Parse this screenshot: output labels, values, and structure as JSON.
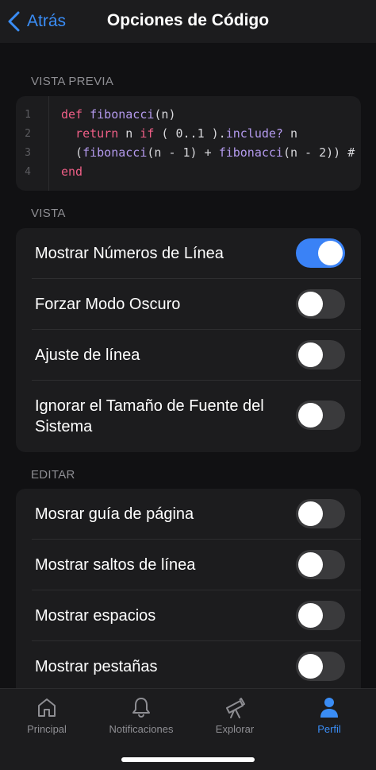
{
  "nav": {
    "back_label": "Atrás",
    "title": "Opciones de Código"
  },
  "preview": {
    "header": "VISTA PREVIA",
    "lines": [
      {
        "number": "1",
        "segments": [
          {
            "text": "def ",
            "kind": "keyword"
          },
          {
            "text": "fibonacci",
            "kind": "function"
          },
          {
            "text": "(n)",
            "kind": "plain"
          }
        ]
      },
      {
        "number": "2",
        "segments": [
          {
            "text": "  return",
            "kind": "keyword"
          },
          {
            "text": " n ",
            "kind": "plain"
          },
          {
            "text": "if",
            "kind": "keyword"
          },
          {
            "text": " ( 0..1 ).",
            "kind": "plain"
          },
          {
            "text": "include?",
            "kind": "function"
          },
          {
            "text": " n",
            "kind": "plain"
          }
        ]
      },
      {
        "number": "3",
        "segments": [
          {
            "text": "  (",
            "kind": "plain"
          },
          {
            "text": "fibonacci",
            "kind": "function"
          },
          {
            "text": "(n - 1) + ",
            "kind": "plain"
          },
          {
            "text": "fibonacci",
            "kind": "function"
          },
          {
            "text": "(n - 2)) #",
            "kind": "plain"
          }
        ]
      },
      {
        "number": "4",
        "segments": [
          {
            "text": "end",
            "kind": "keyword"
          }
        ]
      }
    ]
  },
  "vista": {
    "header": "VISTA",
    "items": [
      {
        "label": "Mostrar Números de Línea",
        "on": true
      },
      {
        "label": "Forzar Modo Oscuro",
        "on": false
      },
      {
        "label": "Ajuste de línea",
        "on": false
      },
      {
        "label": "Ignorar el Tamaño de Fuente del Sistema",
        "on": false
      }
    ]
  },
  "editar": {
    "header": "EDITAR",
    "items": [
      {
        "label": "Mosrar guía de página",
        "on": false
      },
      {
        "label": "Mostrar saltos de línea",
        "on": false
      },
      {
        "label": "Mostrar espacios",
        "on": false
      },
      {
        "label": "Mostrar pestañas",
        "on": false
      }
    ]
  },
  "tabbar": {
    "items": [
      {
        "label": "Principal",
        "icon": "home-icon",
        "active": false
      },
      {
        "label": "Notificaciones",
        "icon": "bell-icon",
        "active": false
      },
      {
        "label": "Explorar",
        "icon": "telescope-icon",
        "active": false
      },
      {
        "label": "Perfil",
        "icon": "person-icon",
        "active": true
      }
    ]
  },
  "colors": {
    "accent": "#3a8df6",
    "toggle_on": "#3a82f6",
    "keyword": "#f05f87",
    "function": "#b49aee"
  }
}
